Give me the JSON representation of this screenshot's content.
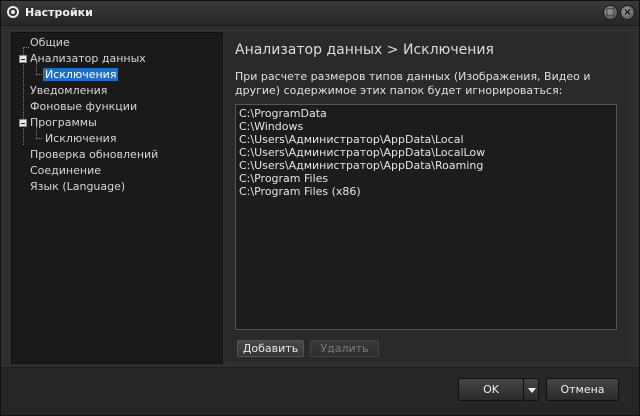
{
  "window": {
    "title": "Настройки"
  },
  "tree": {
    "items": [
      {
        "label": "Общие"
      },
      {
        "label": "Анализатор данных"
      },
      {
        "label": "Исключения"
      },
      {
        "label": "Уведомления"
      },
      {
        "label": "Фоновые функции"
      },
      {
        "label": "Программы"
      },
      {
        "label": "Исключения"
      },
      {
        "label": "Проверка обновлений"
      },
      {
        "label": "Соединение"
      },
      {
        "label": "Язык (Language)"
      }
    ]
  },
  "panel": {
    "title": "Анализатор данных > Исключения",
    "description": "При расчете размеров типов данных (Изображения, Видео и другие) содержимое этих папок будет игнорироваться:",
    "folders": [
      "C:\\ProgramData",
      "C:\\Windows",
      "C:\\Users\\Администратор\\AppData\\Local",
      "C:\\Users\\Администратор\\AppData\\LocalLow",
      "C:\\Users\\Администратор\\AppData\\Roaming",
      "C:\\Program Files",
      "C:\\Program Files (x86)"
    ],
    "add_label": "Добавить",
    "remove_label": "Удалить"
  },
  "footer": {
    "ok_label": "OK",
    "cancel_label": "Отмена"
  }
}
